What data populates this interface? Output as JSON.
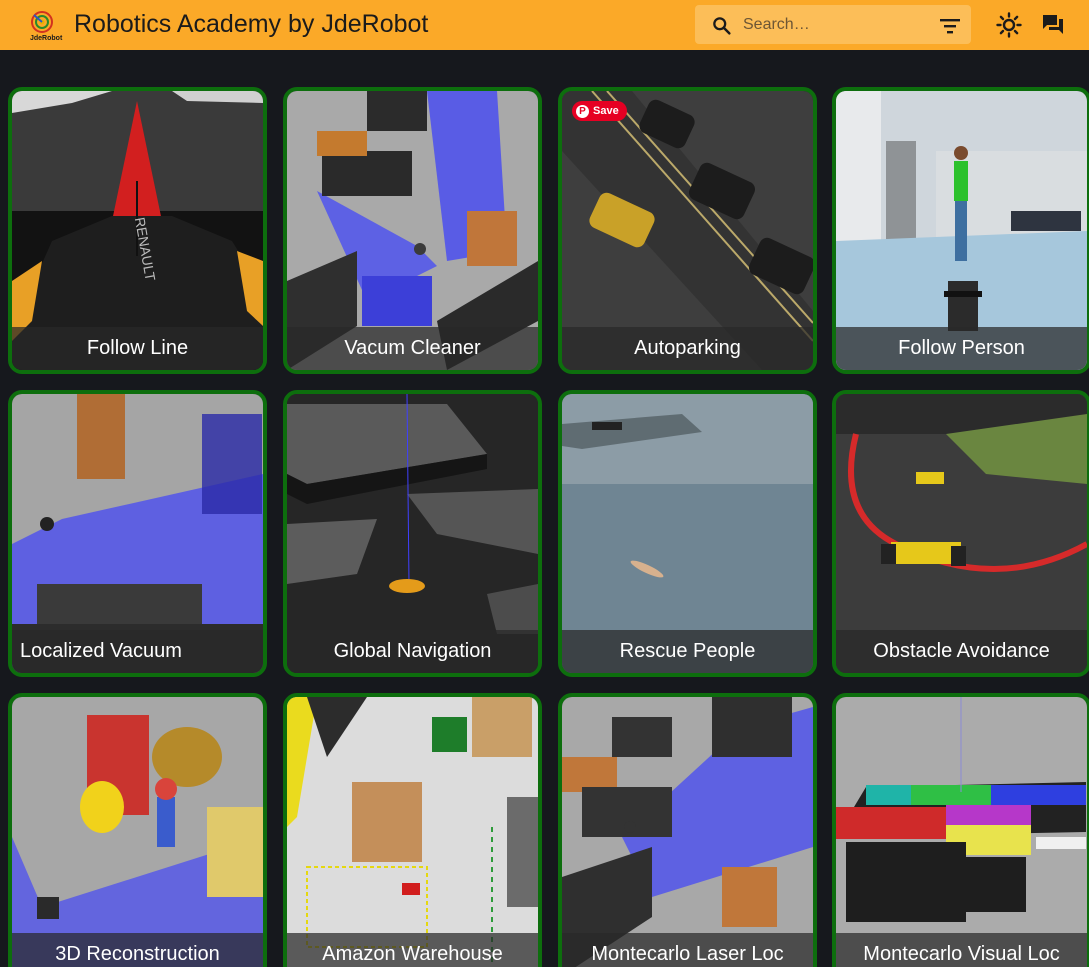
{
  "header": {
    "logo_text": "JdeRobot",
    "title": "Robotics Academy by JdeRobot",
    "search_placeholder": "Search…",
    "icons": [
      "search-icon",
      "filter-icon",
      "light-mode-icon",
      "forum-icon"
    ]
  },
  "colors": {
    "appbar": "#fba928",
    "card_border": "#0d6e0d",
    "background": "#16181d",
    "save_button": "#e60023"
  },
  "save_label": "Save",
  "exercises": [
    {
      "title": "Follow Line"
    },
    {
      "title": "Vacum Cleaner"
    },
    {
      "title": "Autoparking"
    },
    {
      "title": "Follow Person"
    },
    {
      "title": "Localized Vacuum"
    },
    {
      "title": "Global Navigation"
    },
    {
      "title": "Rescue People"
    },
    {
      "title": "Obstacle Avoidance"
    },
    {
      "title": "3D Reconstruction"
    },
    {
      "title": "Amazon Warehouse"
    },
    {
      "title": "Montecarlo Laser Loc"
    },
    {
      "title": "Montecarlo Visual Loc"
    }
  ]
}
